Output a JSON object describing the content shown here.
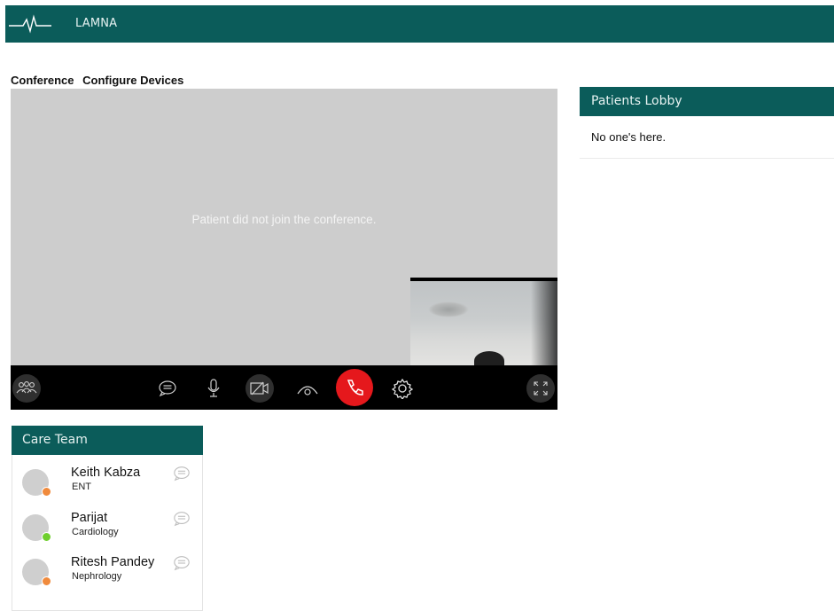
{
  "app": {
    "title": "LAMNA"
  },
  "tabs": [
    "Conference",
    "Configure Devices"
  ],
  "video": {
    "message": "Patient did not join the conference."
  },
  "controls": {
    "icons": [
      "people-icon",
      "chat-icon",
      "microphone-icon",
      "camera-off-icon",
      "recording-icon",
      "hang-up-icon",
      "settings-icon",
      "fullscreen-icon"
    ],
    "hangup_color": "#e5181c"
  },
  "lobby": {
    "title": "Patients Lobby",
    "empty_text": "No one's here."
  },
  "care_team": {
    "title": "Care Team",
    "members": [
      {
        "name": "Keith Kabza",
        "department": "ENT",
        "status_color": "#f08a3c"
      },
      {
        "name": "Parijat",
        "department": "Cardiology",
        "status_color": "#6fcf2e"
      },
      {
        "name": "Ritesh Pandey",
        "department": "Nephrology",
        "status_color": "#f08a3c"
      }
    ]
  },
  "colors": {
    "accent": "#0b5c5a",
    "video_bg": "#cdcdcd",
    "control_bar": "#000000"
  }
}
